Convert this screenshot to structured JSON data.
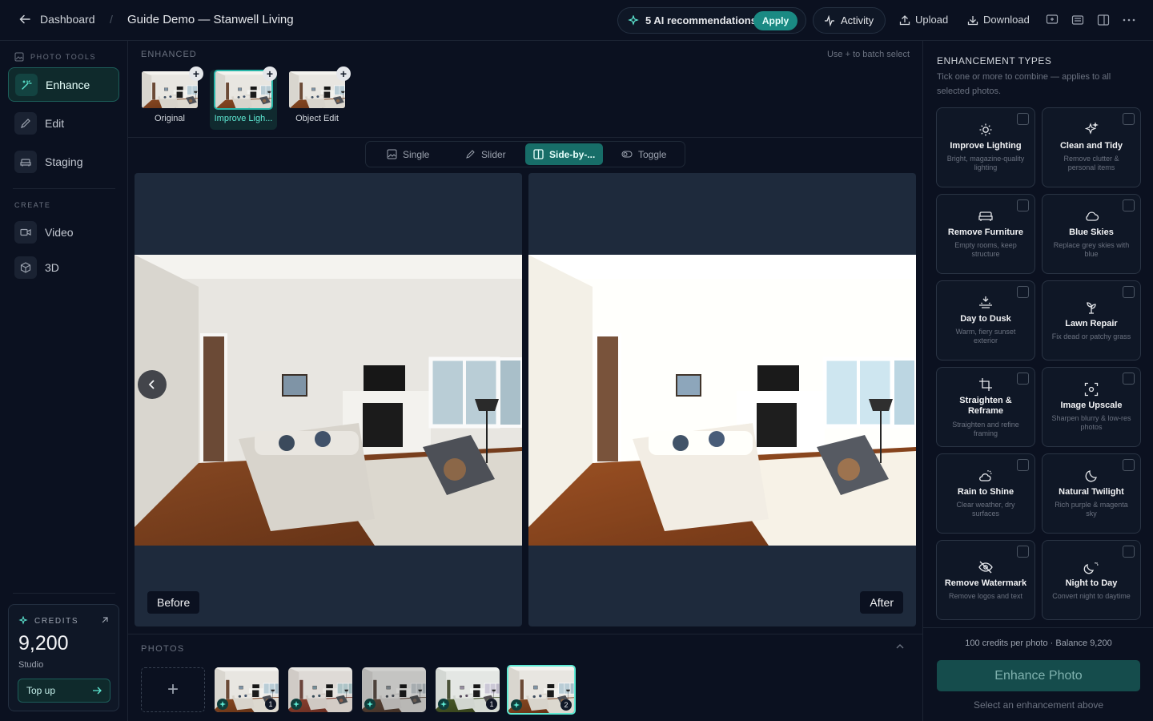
{
  "header": {
    "back_label": "Dashboard",
    "separator": "/",
    "title": "Guide Demo — Stanwell Living",
    "ai_recommendations": "5 AI recommendations",
    "apply_label": "Apply",
    "activity_label": "Activity",
    "upload_label": "Upload",
    "download_label": "Download"
  },
  "sidebar": {
    "photo_tools_label": "PHOTO TOOLS",
    "tools": [
      {
        "label": "Enhance",
        "icon": "magic-wand-icon",
        "active": true
      },
      {
        "label": "Edit",
        "icon": "pencil-icon"
      },
      {
        "label": "Staging",
        "icon": "sofa-icon"
      }
    ],
    "create_label": "CREATE",
    "create_items": [
      {
        "label": "Video",
        "icon": "video-icon"
      },
      {
        "label": "3D",
        "icon": "cube-icon"
      }
    ],
    "credits": {
      "label": "CREDITS",
      "value": "9,200",
      "plan": "Studio",
      "topup_label": "Top up"
    }
  },
  "enhanced": {
    "label": "ENHANCED",
    "hint": "Use + to batch select",
    "versions": [
      {
        "label": "Original"
      },
      {
        "label": "Improve Ligh...",
        "active": true
      },
      {
        "label": "Object Edit"
      }
    ]
  },
  "view_modes": [
    {
      "label": "Single",
      "icon": "image-icon"
    },
    {
      "label": "Slider",
      "icon": "pen-icon"
    },
    {
      "label": "Side-by-...",
      "icon": "columns-icon",
      "active": true
    },
    {
      "label": "Toggle",
      "icon": "toggle-icon"
    }
  ],
  "compare": {
    "before_label": "Before",
    "after_label": "After"
  },
  "photos": {
    "label": "PHOTOS",
    "items": [
      {
        "badge": "1"
      },
      {
        "badge": ""
      },
      {
        "badge": ""
      },
      {
        "badge": "1"
      },
      {
        "badge": "2",
        "active": true
      }
    ]
  },
  "enhancements": {
    "title": "ENHANCEMENT TYPES",
    "subtitle": "Tick one or more to combine — applies to all selected photos.",
    "types": [
      {
        "title": "Improve Lighting",
        "desc": "Bright, magazine-quality lighting",
        "icon": "sun-icon"
      },
      {
        "title": "Clean and Tidy",
        "desc": "Remove clutter & personal items",
        "icon": "sparkles-icon"
      },
      {
        "title": "Remove Furniture",
        "desc": "Empty rooms, keep structure",
        "icon": "sofa-icon"
      },
      {
        "title": "Blue Skies",
        "desc": "Replace grey skies with blue",
        "icon": "cloud-icon"
      },
      {
        "title": "Day to Dusk",
        "desc": "Warm, fiery sunset exterior",
        "icon": "sunset-icon"
      },
      {
        "title": "Lawn Repair",
        "desc": "Fix dead or patchy grass",
        "icon": "sprout-icon"
      },
      {
        "title": "Straighten & Reframe",
        "desc": "Straighten and refine framing",
        "icon": "crop-icon"
      },
      {
        "title": "Image Upscale",
        "desc": "Sharpen blurry & low-res photos",
        "icon": "focus-icon"
      },
      {
        "title": "Rain to Shine",
        "desc": "Clear weather, dry surfaces",
        "icon": "cloud-sun-icon"
      },
      {
        "title": "Natural Twilight",
        "desc": "Rich purple & magenta sky",
        "icon": "moon-icon"
      },
      {
        "title": "Remove Watermark",
        "desc": "Remove logos and text",
        "icon": "eye-off-icon"
      },
      {
        "title": "Night to Day",
        "desc": "Convert night to daytime",
        "icon": "moon-sun-icon"
      }
    ],
    "cost_text": "100 credits per photo · Balance 9,200",
    "button_label": "Enhance Photo",
    "hint": "Select an enhancement above"
  },
  "colors": {
    "accent": "#1a8a83",
    "accent_light": "#5eead4",
    "background": "#0b1120",
    "panel": "#1e2a3c"
  }
}
